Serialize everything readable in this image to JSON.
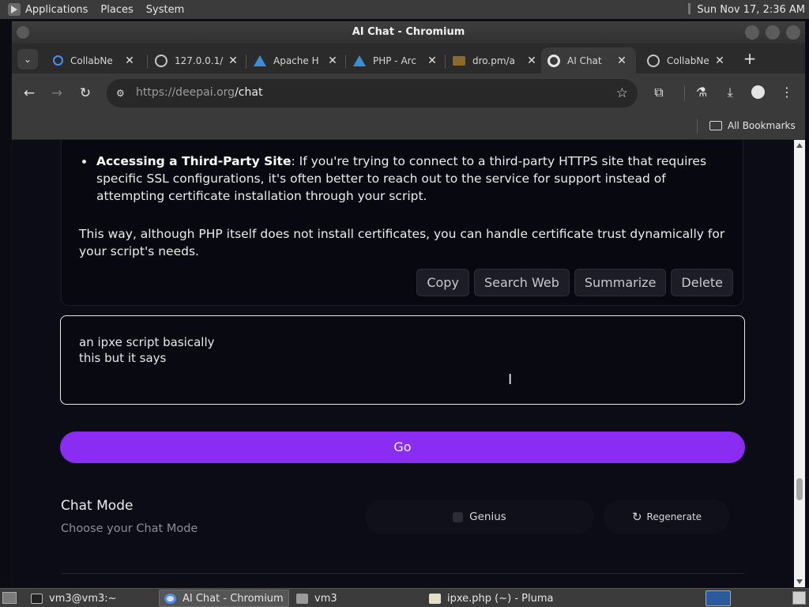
{
  "os_panel": {
    "menus": [
      "Applications",
      "Places",
      "System"
    ],
    "clock": "Sun Nov 17,  2:36 AM"
  },
  "window": {
    "title": "AI Chat - Chromium"
  },
  "tabs": [
    {
      "label": "CollabNe",
      "icon": "search-favicon"
    },
    {
      "label": "127.0.0.1/",
      "icon": "globe-favicon"
    },
    {
      "label": "Apache H",
      "icon": "arch-favicon"
    },
    {
      "label": "PHP - Arc",
      "icon": "arch-favicon"
    },
    {
      "label": "dro.pm/a",
      "icon": "folder-favicon"
    },
    {
      "label": "AI Chat",
      "icon": "chrome-favicon",
      "active": true
    },
    {
      "label": "CollabNe",
      "icon": "globe-favicon"
    }
  ],
  "toolbar": {
    "url_host": "https://deepai.org",
    "url_path": "/chat"
  },
  "bookmarks": {
    "all_bookmarks": "All Bookmarks"
  },
  "message": {
    "bullet_bold": "Accessing a Third-Party Site",
    "bullet_rest": ": If you're trying to connect to a third-party HTTPS site that requires specific SSL configurations, it's often better to reach out to the service for support instead of attempting certificate installation through your script.",
    "paragraph": "This way, although PHP itself does not install certificates, you can handle certificate trust dynamically for your script's needs.",
    "actions": [
      "Copy",
      "Search Web",
      "Summarize",
      "Delete"
    ]
  },
  "chat_input": {
    "value": "an ipxe script basically\nthis but it says"
  },
  "go_label": "Go",
  "chat_mode": {
    "title": "Chat Mode",
    "subtitle": "Choose your Chat Mode",
    "genius_label": "Genius",
    "regenerate_label": "Regenerate"
  },
  "taskbar": {
    "items": [
      {
        "label": "vm3@vm3:~",
        "icon": "terminal-icon"
      },
      {
        "label": "AI Chat - Chromium",
        "icon": "chromium-icon",
        "active": true
      },
      {
        "label": "vm3",
        "icon": "folder-icon"
      },
      {
        "label": "ipxe.php (~) - Pluma",
        "icon": "text-editor-icon"
      }
    ]
  },
  "colors": {
    "accent": "#8a2cf2",
    "page_bg": "#0c0c16"
  }
}
